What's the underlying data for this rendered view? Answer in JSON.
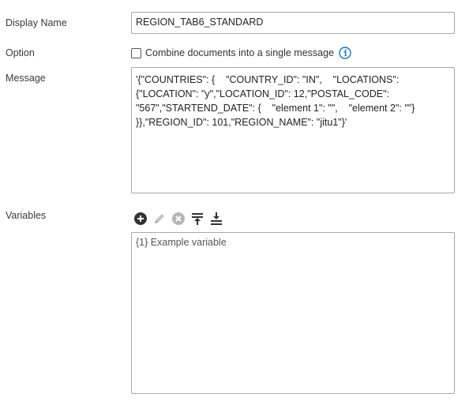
{
  "labels": {
    "display_name": "Display Name",
    "option": "Option",
    "message": "Message",
    "variables": "Variables"
  },
  "display_name_value": "REGION_TAB6_STANDARD",
  "option": {
    "checkbox_label": "Combine documents into a single message",
    "checked": false
  },
  "message_value": "'{\"COUNTRIES\": {    \"COUNTRY_ID\": \"IN\",    \"LOCATIONS\":\n{\"LOCATION\": \"y\",\"LOCATION_ID\": 12,\"POSTAL_CODE\":\n\"567\",\"STARTEND_DATE\": {    \"element 1\": \"\",    \"element 2\": \"\"}\n}},\"REGION_ID\": 101,\"REGION_NAME\": \"jitu1\"}'",
  "variables_toolbar": [
    "add-icon",
    "edit-icon",
    "remove-icon",
    "move-top-icon",
    "move-bottom-icon"
  ],
  "variables_items": [
    "{1} Example variable"
  ],
  "colors": {
    "info_accent": "#1a73b8",
    "icon_dark": "#333333",
    "icon_disabled": "#b5b5b5"
  }
}
